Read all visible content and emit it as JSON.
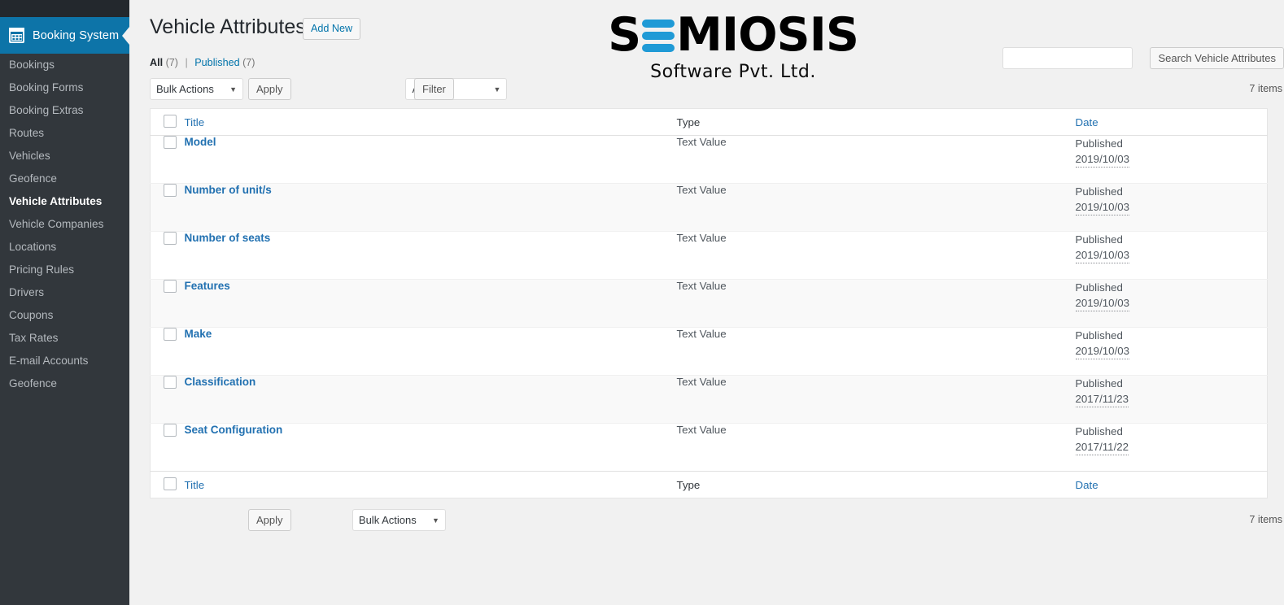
{
  "sidebar": {
    "brand": {
      "label": "Booking System",
      "icon": "calendar-icon"
    },
    "items": [
      {
        "label": "Bookings",
        "current": false
      },
      {
        "label": "Booking Forms",
        "current": false
      },
      {
        "label": "Booking Extras",
        "current": false
      },
      {
        "label": "Routes",
        "current": false
      },
      {
        "label": "Vehicles",
        "current": false
      },
      {
        "label": "Geofence",
        "current": false
      },
      {
        "label": "Vehicle Attributes",
        "current": true
      },
      {
        "label": "Vehicle Companies",
        "current": false
      },
      {
        "label": "Locations",
        "current": false
      },
      {
        "label": "Pricing Rules",
        "current": false
      },
      {
        "label": "Drivers",
        "current": false
      },
      {
        "label": "Coupons",
        "current": false
      },
      {
        "label": "Tax Rates",
        "current": false
      },
      {
        "label": "E-mail Accounts",
        "current": false
      },
      {
        "label": "Geofence",
        "current": false
      }
    ]
  },
  "header": {
    "page_title": "Vehicle Attributes",
    "add_new_label": "Add New"
  },
  "logo": {
    "word_before": "S",
    "word_after": "MIOSIS",
    "subtitle": "Software Pvt. Ltd.",
    "accent_color": "#1f9ad6"
  },
  "views": {
    "all_label": "All",
    "all_count": "(7)",
    "separator": "|",
    "published_label": "Published",
    "published_count": "(7)"
  },
  "search": {
    "value": "",
    "placeholder": "",
    "button_label": "Search Vehicle Attributes"
  },
  "toolbar": {
    "bulk_actions_label": "Bulk Actions",
    "apply_label": "Apply",
    "all_dates_label": "All dates",
    "filter_label": "Filter",
    "items_count": "7 items"
  },
  "table": {
    "columns": {
      "title": "Title",
      "type": "Type",
      "date": "Date"
    },
    "rows": [
      {
        "title": "Model",
        "type": "Text Value",
        "status": "Published",
        "date": "2019/10/03"
      },
      {
        "title": "Number of unit/s",
        "type": "Text Value",
        "status": "Published",
        "date": "2019/10/03"
      },
      {
        "title": "Number of seats",
        "type": "Text Value",
        "status": "Published",
        "date": "2019/10/03"
      },
      {
        "title": "Features",
        "type": "Text Value",
        "status": "Published",
        "date": "2019/10/03"
      },
      {
        "title": "Make",
        "type": "Text Value",
        "status": "Published",
        "date": "2019/10/03"
      },
      {
        "title": "Classification",
        "type": "Text Value",
        "status": "Published",
        "date": "2017/11/23"
      },
      {
        "title": "Seat Configuration",
        "type": "Text Value",
        "status": "Published",
        "date": "2017/11/22"
      }
    ]
  }
}
